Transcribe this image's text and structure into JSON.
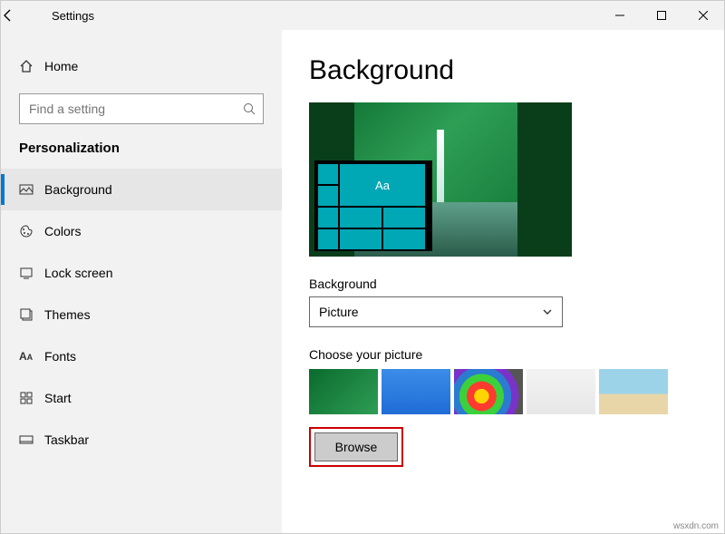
{
  "window": {
    "title": "Settings"
  },
  "sidebar": {
    "home": "Home",
    "search_placeholder": "Find a setting",
    "category": "Personalization",
    "items": [
      {
        "label": "Background"
      },
      {
        "label": "Colors"
      },
      {
        "label": "Lock screen"
      },
      {
        "label": "Themes"
      },
      {
        "label": "Fonts"
      },
      {
        "label": "Start"
      },
      {
        "label": "Taskbar"
      }
    ]
  },
  "content": {
    "heading": "Background",
    "preview_tile_text": "Aa",
    "bg_label": "Background",
    "bg_value": "Picture",
    "choose_label": "Choose your picture",
    "browse": "Browse"
  },
  "colors": {
    "accent": "#0078d4",
    "tile": "#00a7b5",
    "highlight_border": "#c00"
  },
  "watermark": "wsxdn.com"
}
